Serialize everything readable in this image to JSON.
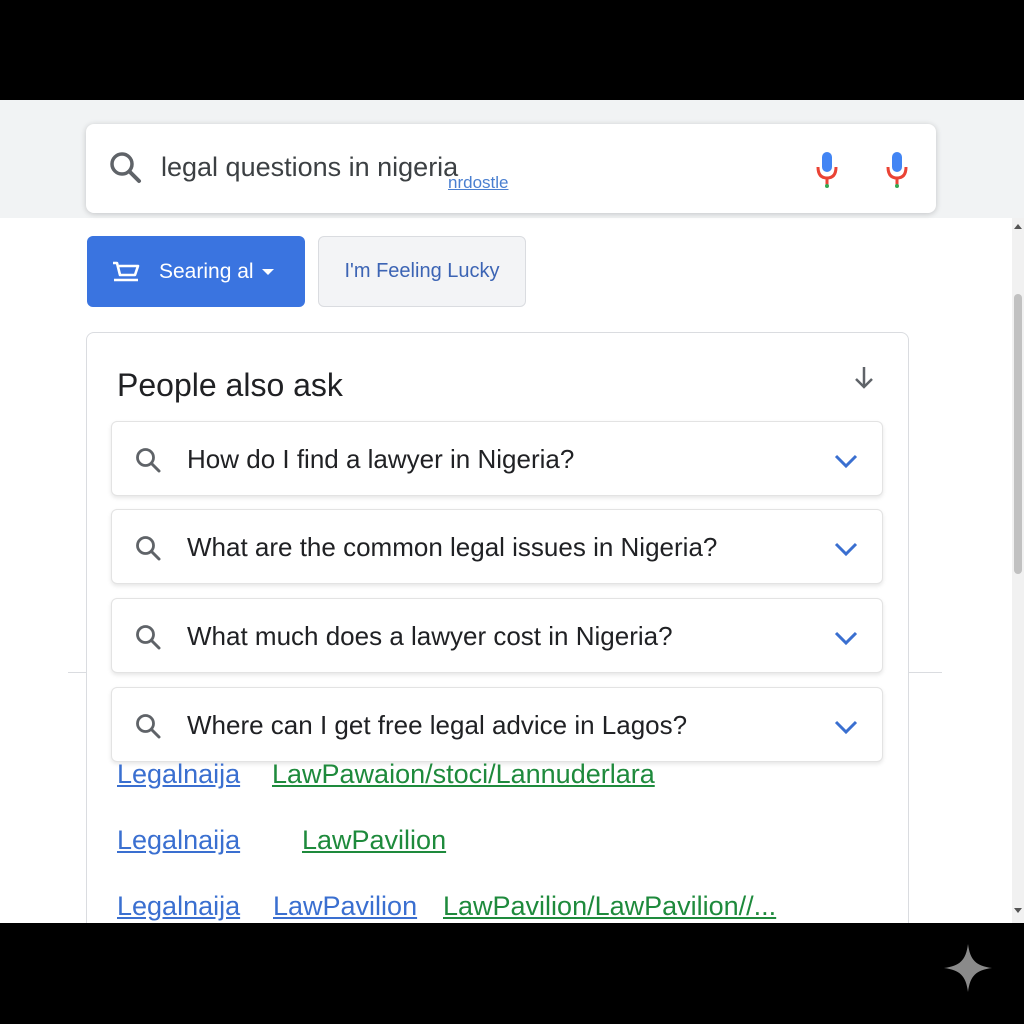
{
  "search": {
    "query": "legal questions in nigeria",
    "suggestion": "nrdostle"
  },
  "buttons": {
    "primary_label": "Searing al",
    "secondary_label": "I'm Feeling Lucky"
  },
  "paa": {
    "title": "People also ask",
    "items": [
      {
        "label": "How do I find a lawyer in Nigeria?"
      },
      {
        "label": "What are the common legal issues in Nigeria?"
      },
      {
        "label": "What much does a lawyer cost in Nigeria?"
      },
      {
        "label": "Where can I get free legal advice in Lagos?"
      }
    ]
  },
  "results": [
    {
      "site": "Legalnaija",
      "path": "LawPawaion/stoci/Lannuderlara"
    },
    {
      "site": "Legalnaija",
      "path": "LawPavilion"
    },
    {
      "site": "Legalnaija",
      "path": "LawPavilion",
      "path2": "LawPavilion/LawPavilion//..."
    }
  ],
  "colors": {
    "primary_button": "#3a74e0",
    "link_blue": "#3a6fd0",
    "link_green": "#1e8a3c",
    "mic_blue": "#4285f4",
    "mic_red": "#ea4335"
  },
  "icons": [
    "search-icon",
    "microphone-icon",
    "cart-icon",
    "caret-down-icon",
    "arrow-down-icon",
    "chevron-down-icon",
    "sparkle-icon"
  ]
}
